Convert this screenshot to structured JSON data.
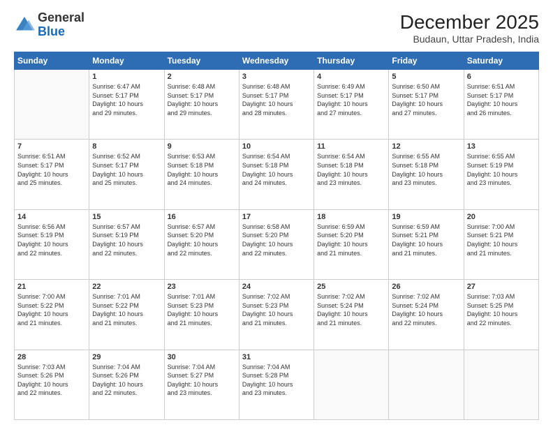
{
  "logo": {
    "general": "General",
    "blue": "Blue"
  },
  "header": {
    "month": "December 2025",
    "location": "Budaun, Uttar Pradesh, India"
  },
  "weekdays": [
    "Sunday",
    "Monday",
    "Tuesday",
    "Wednesday",
    "Thursday",
    "Friday",
    "Saturday"
  ],
  "weeks": [
    [
      {
        "day": "",
        "info": ""
      },
      {
        "day": "1",
        "info": "Sunrise: 6:47 AM\nSunset: 5:17 PM\nDaylight: 10 hours\nand 29 minutes."
      },
      {
        "day": "2",
        "info": "Sunrise: 6:48 AM\nSunset: 5:17 PM\nDaylight: 10 hours\nand 29 minutes."
      },
      {
        "day": "3",
        "info": "Sunrise: 6:48 AM\nSunset: 5:17 PM\nDaylight: 10 hours\nand 28 minutes."
      },
      {
        "day": "4",
        "info": "Sunrise: 6:49 AM\nSunset: 5:17 PM\nDaylight: 10 hours\nand 27 minutes."
      },
      {
        "day": "5",
        "info": "Sunrise: 6:50 AM\nSunset: 5:17 PM\nDaylight: 10 hours\nand 27 minutes."
      },
      {
        "day": "6",
        "info": "Sunrise: 6:51 AM\nSunset: 5:17 PM\nDaylight: 10 hours\nand 26 minutes."
      }
    ],
    [
      {
        "day": "7",
        "info": "Sunrise: 6:51 AM\nSunset: 5:17 PM\nDaylight: 10 hours\nand 25 minutes."
      },
      {
        "day": "8",
        "info": "Sunrise: 6:52 AM\nSunset: 5:17 PM\nDaylight: 10 hours\nand 25 minutes."
      },
      {
        "day": "9",
        "info": "Sunrise: 6:53 AM\nSunset: 5:18 PM\nDaylight: 10 hours\nand 24 minutes."
      },
      {
        "day": "10",
        "info": "Sunrise: 6:54 AM\nSunset: 5:18 PM\nDaylight: 10 hours\nand 24 minutes."
      },
      {
        "day": "11",
        "info": "Sunrise: 6:54 AM\nSunset: 5:18 PM\nDaylight: 10 hours\nand 23 minutes."
      },
      {
        "day": "12",
        "info": "Sunrise: 6:55 AM\nSunset: 5:18 PM\nDaylight: 10 hours\nand 23 minutes."
      },
      {
        "day": "13",
        "info": "Sunrise: 6:55 AM\nSunset: 5:19 PM\nDaylight: 10 hours\nand 23 minutes."
      }
    ],
    [
      {
        "day": "14",
        "info": "Sunrise: 6:56 AM\nSunset: 5:19 PM\nDaylight: 10 hours\nand 22 minutes."
      },
      {
        "day": "15",
        "info": "Sunrise: 6:57 AM\nSunset: 5:19 PM\nDaylight: 10 hours\nand 22 minutes."
      },
      {
        "day": "16",
        "info": "Sunrise: 6:57 AM\nSunset: 5:20 PM\nDaylight: 10 hours\nand 22 minutes."
      },
      {
        "day": "17",
        "info": "Sunrise: 6:58 AM\nSunset: 5:20 PM\nDaylight: 10 hours\nand 22 minutes."
      },
      {
        "day": "18",
        "info": "Sunrise: 6:59 AM\nSunset: 5:20 PM\nDaylight: 10 hours\nand 21 minutes."
      },
      {
        "day": "19",
        "info": "Sunrise: 6:59 AM\nSunset: 5:21 PM\nDaylight: 10 hours\nand 21 minutes."
      },
      {
        "day": "20",
        "info": "Sunrise: 7:00 AM\nSunset: 5:21 PM\nDaylight: 10 hours\nand 21 minutes."
      }
    ],
    [
      {
        "day": "21",
        "info": "Sunrise: 7:00 AM\nSunset: 5:22 PM\nDaylight: 10 hours\nand 21 minutes."
      },
      {
        "day": "22",
        "info": "Sunrise: 7:01 AM\nSunset: 5:22 PM\nDaylight: 10 hours\nand 21 minutes."
      },
      {
        "day": "23",
        "info": "Sunrise: 7:01 AM\nSunset: 5:23 PM\nDaylight: 10 hours\nand 21 minutes."
      },
      {
        "day": "24",
        "info": "Sunrise: 7:02 AM\nSunset: 5:23 PM\nDaylight: 10 hours\nand 21 minutes."
      },
      {
        "day": "25",
        "info": "Sunrise: 7:02 AM\nSunset: 5:24 PM\nDaylight: 10 hours\nand 21 minutes."
      },
      {
        "day": "26",
        "info": "Sunrise: 7:02 AM\nSunset: 5:24 PM\nDaylight: 10 hours\nand 22 minutes."
      },
      {
        "day": "27",
        "info": "Sunrise: 7:03 AM\nSunset: 5:25 PM\nDaylight: 10 hours\nand 22 minutes."
      }
    ],
    [
      {
        "day": "28",
        "info": "Sunrise: 7:03 AM\nSunset: 5:26 PM\nDaylight: 10 hours\nand 22 minutes."
      },
      {
        "day": "29",
        "info": "Sunrise: 7:04 AM\nSunset: 5:26 PM\nDaylight: 10 hours\nand 22 minutes."
      },
      {
        "day": "30",
        "info": "Sunrise: 7:04 AM\nSunset: 5:27 PM\nDaylight: 10 hours\nand 23 minutes."
      },
      {
        "day": "31",
        "info": "Sunrise: 7:04 AM\nSunset: 5:28 PM\nDaylight: 10 hours\nand 23 minutes."
      },
      {
        "day": "",
        "info": ""
      },
      {
        "day": "",
        "info": ""
      },
      {
        "day": "",
        "info": ""
      }
    ]
  ]
}
